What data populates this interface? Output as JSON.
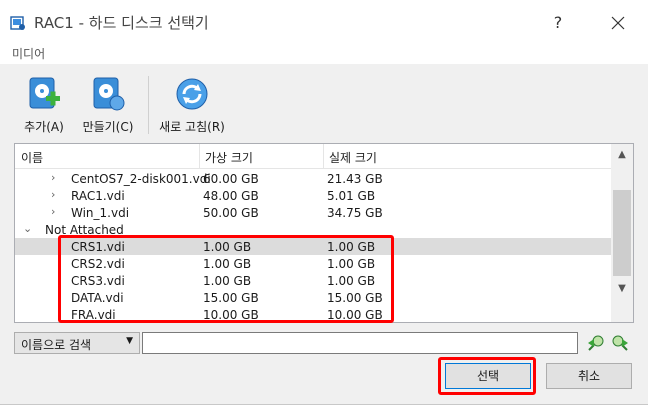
{
  "window": {
    "title": "RAC1 - 하드 디스크 선택기",
    "help_label": "?"
  },
  "menu": {
    "items": [
      "미디어"
    ]
  },
  "toolbar": {
    "add_label": "추가(A)",
    "create_label": "만들기(C)",
    "refresh_label": "새로 고침(R)"
  },
  "table": {
    "columns": [
      "이름",
      "가상 크기",
      "실제 크기"
    ],
    "rows": [
      {
        "name": "CentOS7_2-disk001.vdi",
        "virtual": "60.00 GB",
        "actual": "21.43 GB",
        "level": 1,
        "expander": "›"
      },
      {
        "name": "RAC1.vdi",
        "virtual": "48.00 GB",
        "actual": "5.01 GB",
        "level": 1,
        "expander": "›"
      },
      {
        "name": "Win_1.vdi",
        "virtual": "50.00 GB",
        "actual": "34.75 GB",
        "level": 1,
        "expander": "›"
      },
      {
        "name": "Not Attached",
        "virtual": "",
        "actual": "",
        "level": 0,
        "expander": "⌄"
      },
      {
        "name": "CRS1.vdi",
        "virtual": "1.00 GB",
        "actual": "1.00 GB",
        "level": 1,
        "expander": "",
        "selected": true
      },
      {
        "name": "CRS2.vdi",
        "virtual": "1.00 GB",
        "actual": "1.00 GB",
        "level": 1,
        "expander": ""
      },
      {
        "name": "CRS3.vdi",
        "virtual": "1.00 GB",
        "actual": "1.00 GB",
        "level": 1,
        "expander": ""
      },
      {
        "name": "DATA.vdi",
        "virtual": "15.00 GB",
        "actual": "15.00 GB",
        "level": 1,
        "expander": ""
      },
      {
        "name": "FRA.vdi",
        "virtual": "10.00 GB",
        "actual": "10.00 GB",
        "level": 1,
        "expander": ""
      }
    ]
  },
  "search": {
    "mode_label": "이름으로 검색",
    "value": "",
    "placeholder": ""
  },
  "buttons": {
    "select_label": "선택",
    "cancel_label": "취소"
  },
  "colors": {
    "highlight": "#ff0000",
    "accent": "#0078d7",
    "selected_row": "#dcdcdc"
  }
}
